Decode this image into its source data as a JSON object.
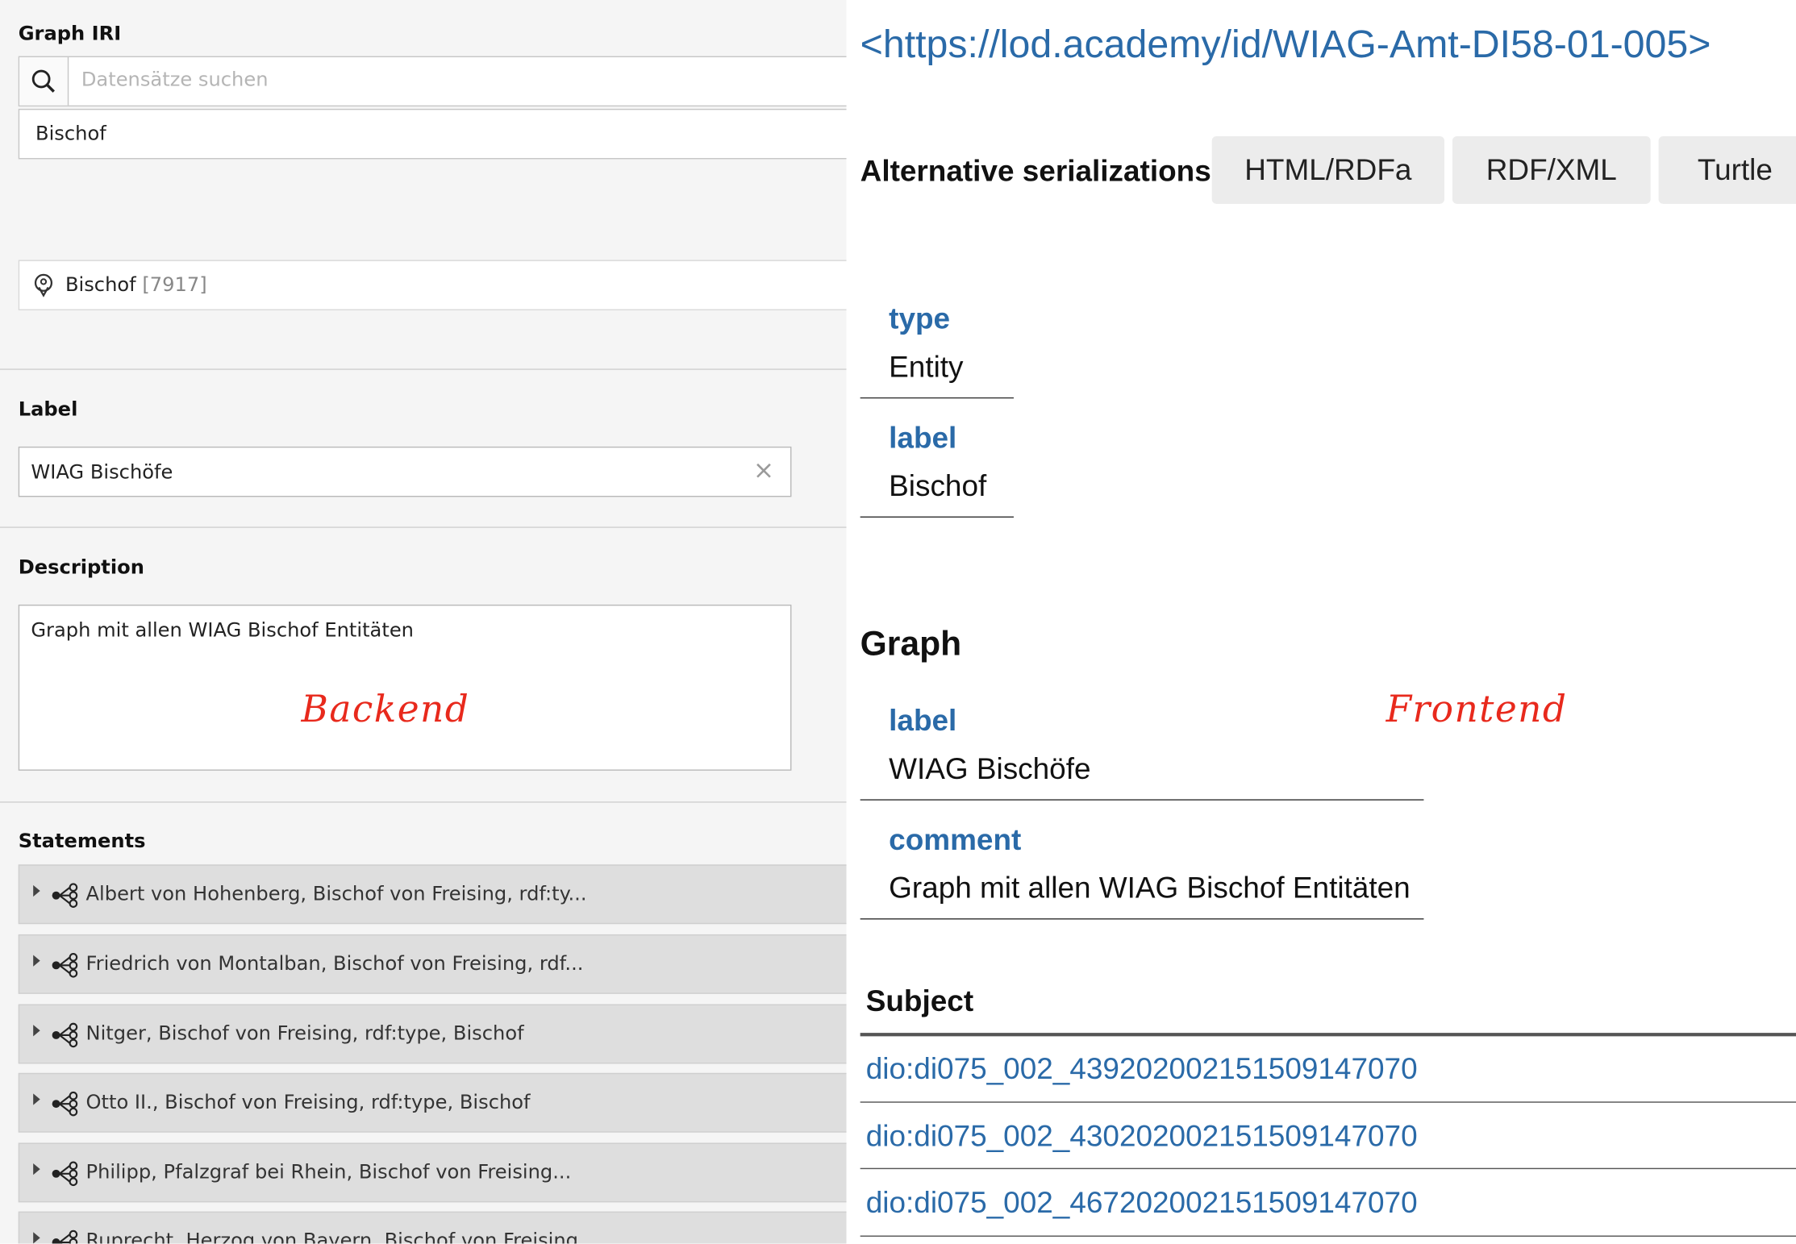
{
  "backend": {
    "graph_iri": {
      "label": "Graph IRI",
      "search_placeholder": "Datensätze suchen",
      "value": "Bischof",
      "item_label": "Bischof",
      "item_id": "[7917]"
    },
    "label_field": {
      "label": "Label",
      "value": "WIAG Bischöfe"
    },
    "description_field": {
      "label": "Description",
      "value": "Graph mit allen WIAG Bischof Entitäten"
    },
    "annotation": "Backend",
    "statements": {
      "label": "Statements",
      "items": [
        "Albert von Hohenberg, Bischof von Freising, rdf:ty...",
        "Friedrich von Montalban, Bischof von Freising, rdf...",
        "Nitger, Bischof von Freising, rdf:type, Bischof",
        "Otto II., Bischof von Freising, rdf:type, Bischof",
        "Philipp, Pfalzgraf bei Rhein, Bischof von Freising...",
        "Ruprecht, Herzog von Bayern, Bischof von Freising"
      ]
    }
  },
  "frontend": {
    "iri": "<https://lod.academy/id/WIAG-Amt-DI58-01-005>",
    "alt_serializations_label": "Alternative serializations:",
    "serializations": [
      "HTML/RDFa",
      "RDF/XML",
      "Turtle"
    ],
    "properties": [
      {
        "key": "type",
        "value": "Entity"
      },
      {
        "key": "label",
        "value": "Bischof"
      }
    ],
    "graph": {
      "heading": "Graph",
      "properties": [
        {
          "key": "label",
          "value": "WIAG Bischöfe"
        },
        {
          "key": "comment",
          "value": "Graph mit allen WIAG Bischof Entitäten"
        }
      ]
    },
    "annotation": "Frontend",
    "subject": {
      "heading": "Subject",
      "links": [
        "dio:di075_002_4392020021515091470​70",
        "dio:di075_002_4302020021515091470​70",
        "dio:di075_002_4672020021515091470​70"
      ]
    }
  }
}
